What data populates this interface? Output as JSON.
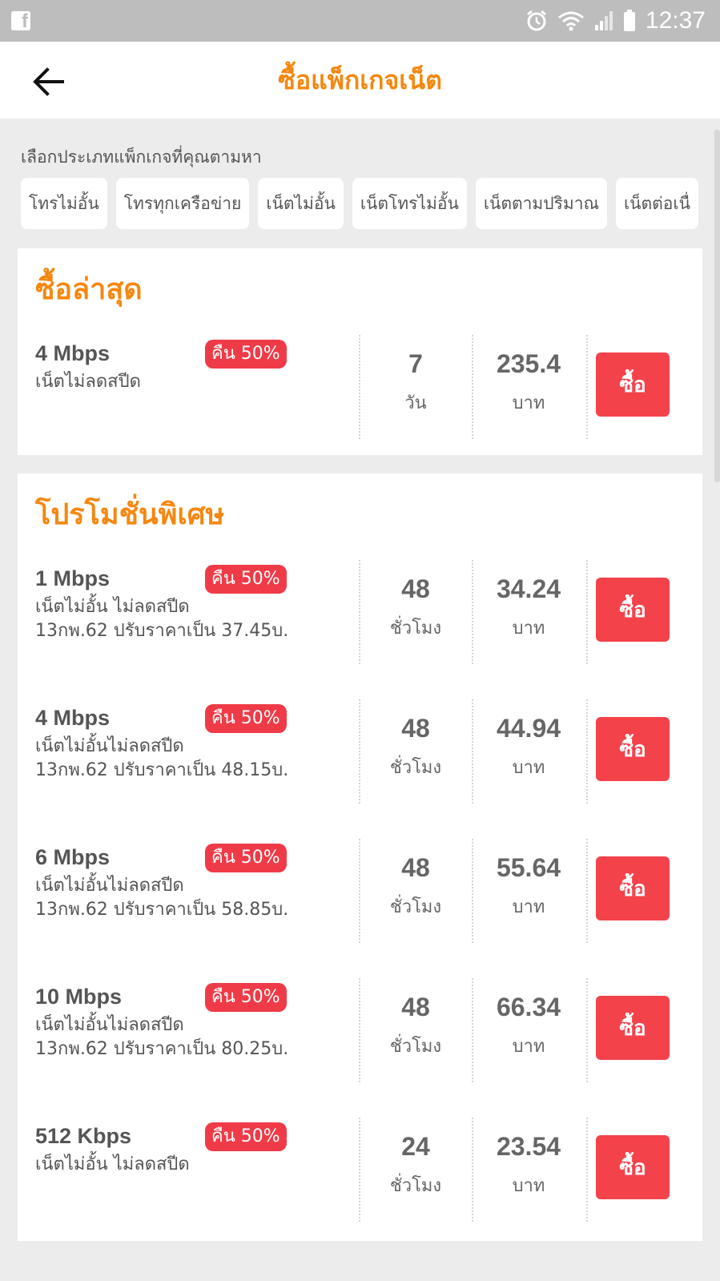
{
  "status_bar": {
    "time": "12:37"
  },
  "header": {
    "title": "ซื้อแพ็กเกจเน็ต"
  },
  "filter": {
    "label": "เลือกประเภทแพ็กเกจที่คุณตามหา",
    "chips": [
      "โทรไม่อั้น",
      "โทรทุกเครือข่าย",
      "เน็ตไม่อั้น",
      "เน็ตโทรไม่อั้น",
      "เน็ตตามปริมาณ",
      "เน็ตต่อเนื่"
    ]
  },
  "recent": {
    "title": "ซื้อล่าสุด",
    "items": [
      {
        "speed": "4 Mbps",
        "badge": "คืน 50%",
        "desc1": "เน็ตไม่ลดสปีด",
        "desc2": "",
        "duration": "7",
        "duration_unit": "วัน",
        "price": "235.4",
        "currency": "บาท",
        "buy": "ซื้อ"
      }
    ]
  },
  "promo": {
    "title": "โปรโมชั่นพิเศษ",
    "items": [
      {
        "speed": "1 Mbps",
        "badge": "คืน 50%",
        "desc1": "เน็ตไม่อั้น ไม่ลดสปีด",
        "desc2": "13กพ.62 ปรับราคาเป็น 37.45บ.",
        "duration": "48",
        "duration_unit": "ชั่วโมง",
        "price": "34.24",
        "currency": "บาท",
        "buy": "ซื้อ"
      },
      {
        "speed": "4 Mbps",
        "badge": "คืน 50%",
        "desc1": "เน็ตไม่อั้นไม่ลดสปีด",
        "desc2": "13กพ.62 ปรับราคาเป็น 48.15บ.",
        "duration": "48",
        "duration_unit": "ชั่วโมง",
        "price": "44.94",
        "currency": "บาท",
        "buy": "ซื้อ"
      },
      {
        "speed": "6 Mbps",
        "badge": "คืน 50%",
        "desc1": "เน็ตไม่อั้นไม่ลดสปีด",
        "desc2": "13กพ.62 ปรับราคาเป็น 58.85บ.",
        "duration": "48",
        "duration_unit": "ชั่วโมง",
        "price": "55.64",
        "currency": "บาท",
        "buy": "ซื้อ"
      },
      {
        "speed": "10 Mbps",
        "badge": "คืน 50%",
        "desc1": "เน็ตไม่อั้นไม่ลดสปีด",
        "desc2": "13กพ.62 ปรับราคาเป็น 80.25บ.",
        "duration": "48",
        "duration_unit": "ชั่วโมง",
        "price": "66.34",
        "currency": "บาท",
        "buy": "ซื้อ"
      },
      {
        "speed": "512 Kbps",
        "badge": "คืน 50%",
        "desc1": "เน็ตไม่อั้น ไม่ลดสปีด",
        "desc2": "",
        "duration": "24",
        "duration_unit": "ชั่วโมง",
        "price": "23.54",
        "currency": "บาท",
        "buy": "ซื้อ"
      }
    ]
  },
  "colors": {
    "accent": "#f5870f",
    "buy": "#f4424b",
    "badge": "#ef3b47",
    "background": "#ececec"
  }
}
